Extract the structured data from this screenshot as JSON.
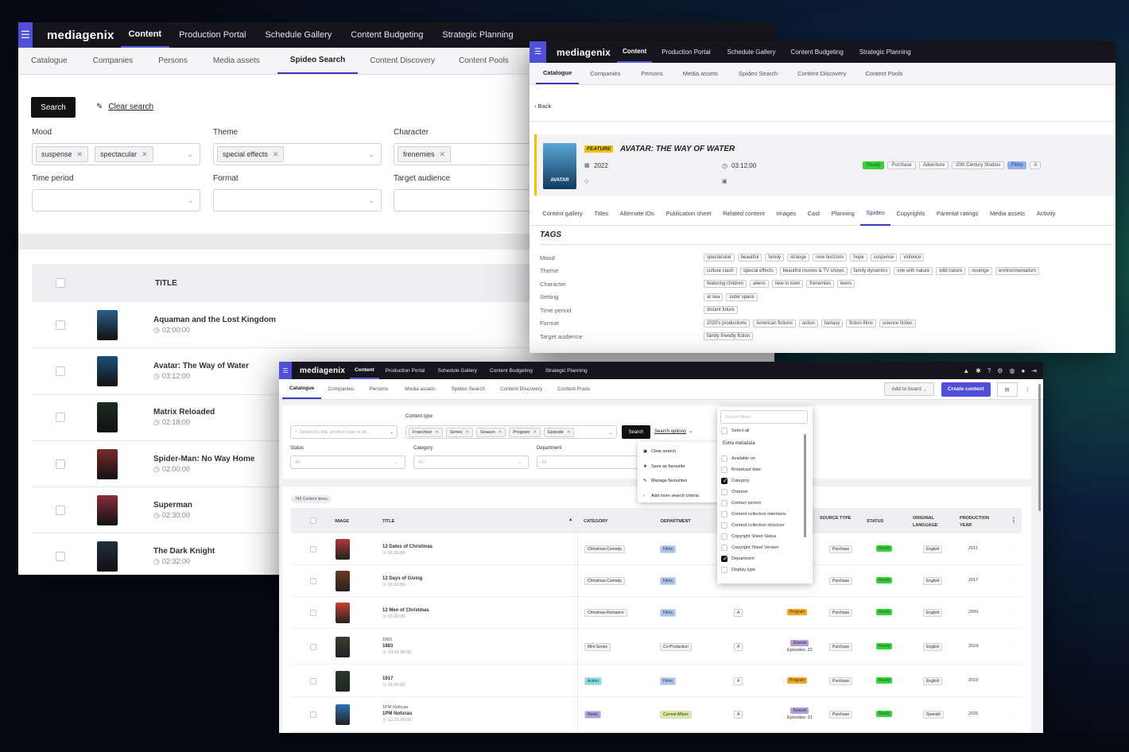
{
  "app": {
    "logo": "mediagenix",
    "top_nav": [
      "Content",
      "Production Portal",
      "Schedule Gallery",
      "Content Budgeting",
      "Strategic Planning"
    ],
    "sub_nav": [
      "Catalogue",
      "Companies",
      "Persons",
      "Media assets",
      "Spideo Search",
      "Content Discovery",
      "Content Pools"
    ]
  },
  "search_window": {
    "search_button": "Search",
    "clear_search": "Clear search",
    "filters": [
      {
        "label": "Mood",
        "chips": [
          "suspense",
          "spectacular"
        ]
      },
      {
        "label": "Theme",
        "chips": [
          "special effects"
        ]
      },
      {
        "label": "Character",
        "chips": [
          "frenemies"
        ]
      },
      {
        "label": "Time period",
        "chips": []
      },
      {
        "label": "Format",
        "chips": []
      },
      {
        "label": "Target audience",
        "chips": []
      }
    ],
    "table_header": "TITLE",
    "rows": [
      {
        "title": "Aquaman and the Lost Kingdom",
        "duration": "02:00:00",
        "color": "#2b5f8a"
      },
      {
        "title": "Avatar: The Way of Water",
        "duration": "03:12:00",
        "color": "#1d4f7a"
      },
      {
        "title": "Matrix Reloaded",
        "duration": "02:18:00",
        "color": "#1d2b22"
      },
      {
        "title": "Spider-Man: No Way Home",
        "duration": "02:00:00",
        "color": "#7a2c2c"
      },
      {
        "title": "Superman",
        "duration": "02:30:00",
        "color": "#8a2d3a"
      },
      {
        "title": "The Dark Knight",
        "duration": "02:32:00",
        "color": "#20303d"
      }
    ]
  },
  "detail_window": {
    "back": "Back",
    "badge": "FEATURE",
    "title": "AVATAR: THE WAY OF WATER",
    "year": "2022",
    "duration": "03:12:00",
    "poster_text": "AVATAR",
    "status_tags": [
      "Ready",
      "Purchase",
      "Adventure",
      "20th Century Studios",
      "Films",
      "A"
    ],
    "tabs": [
      "Content gallery",
      "Titles",
      "Alternate IDs",
      "Publication sheet",
      "Related content",
      "Images",
      "Cast",
      "Planning",
      "Spideo",
      "Copyrights",
      "Parental ratings",
      "Media assets",
      "Activity"
    ],
    "tags_heading": "TAGS",
    "tag_rows": [
      {
        "label": "Mood",
        "tags": [
          "spectacular",
          "beautiful",
          "family",
          "strange",
          "new horizons",
          "hope",
          "suspense",
          "violence"
        ]
      },
      {
        "label": "Theme",
        "tags": [
          "culture clash",
          "special effects",
          "beautiful movies & TV shows",
          "family dynamics",
          "one with nature",
          "wild nature",
          "revenge",
          "environmentalism"
        ]
      },
      {
        "label": "Character",
        "tags": [
          "featuring children",
          "aliens",
          "new in town",
          "frenemies",
          "teens"
        ]
      },
      {
        "label": "Setting",
        "tags": [
          "at sea",
          "outer space"
        ]
      },
      {
        "label": "Time period",
        "tags": [
          "distant future"
        ]
      },
      {
        "label": "Format",
        "tags": [
          "2020's productions",
          "American fictions",
          "action",
          "fantasy",
          "fiction films",
          "science fiction"
        ]
      },
      {
        "label": "Target audience",
        "tags": [
          "family friendly fiction"
        ]
      }
    ]
  },
  "catalogue_window": {
    "add_to_board": "Add to board",
    "create_content": "Create content",
    "search_placeholder": "Search by title, product code or alt...",
    "content_type_label": "Content type",
    "content_types": [
      "Franchise",
      "Series",
      "Season",
      "Program",
      "Episode"
    ],
    "search_button": "Search",
    "search_options": "Search options",
    "status_label": "Status",
    "category_label": "Category",
    "department_label": "Department",
    "all": "All",
    "options_menu": [
      "Clear search",
      "Save as favourite",
      "Manage favourites",
      "Add more search criteria"
    ],
    "filter_panel": {
      "placeholder": "Search filters",
      "select_all": "Select all",
      "section": "Extra metadata",
      "items": [
        {
          "label": "Available on",
          "checked": false
        },
        {
          "label": "Broadcast date",
          "checked": false
        },
        {
          "label": "Category",
          "checked": true
        },
        {
          "label": "Channel",
          "checked": false
        },
        {
          "label": "Contact person",
          "checked": false
        },
        {
          "label": "Content collection intentions",
          "checked": false
        },
        {
          "label": "Content collection structure",
          "checked": false
        },
        {
          "label": "Copyright Sheet Status",
          "checked": false
        },
        {
          "label": "Copyright Sheet Version",
          "checked": false
        },
        {
          "label": "Department",
          "checked": true
        },
        {
          "label": "Display type",
          "checked": false
        }
      ]
    },
    "count": "743 Content items",
    "columns": [
      "IMAGE",
      "TITLE",
      "CATEGORY",
      "DEPARTMENT",
      "SOURCE TYPE",
      "STATUS",
      "ORIGINAL LANGUAGE",
      "PRODUCTION YEAR"
    ],
    "rows": [
      {
        "pre": "",
        "title": "12 Dates of Christmas",
        "sub": "01:30:00",
        "category": "Christmas-Comedy",
        "cat_color": "#f3f3f5",
        "department": "Films",
        "dep_color": "#a7c4f2",
        "rating": "",
        "type": "",
        "type_color": "",
        "episodes": "",
        "source": "Purchase",
        "status": "Ready",
        "lang": "English",
        "year": "2011",
        "img": "#b03a3a"
      },
      {
        "pre": "",
        "title": "12 Days of Giving",
        "sub": "01:30:00",
        "category": "Christmas-Comedy",
        "cat_color": "#f3f3f5",
        "department": "Films",
        "dep_color": "#a7c4f2",
        "rating": "",
        "type": "",
        "type_color": "",
        "episodes": "",
        "source": "Purchase",
        "status": "Ready",
        "lang": "English",
        "year": "2017",
        "img": "#6b3b1e"
      },
      {
        "pre": "",
        "title": "12 Men of Christmas",
        "sub": "01:30:00",
        "category": "Christmas-Romance",
        "cat_color": "#f3f3f5",
        "department": "Films",
        "dep_color": "#a7c4f2",
        "rating": "A",
        "type": "Program",
        "type_color": "#f5a623",
        "episodes": "",
        "source": "Purchase",
        "status": "Ready",
        "lang": "English",
        "year": "2009",
        "img": "#c8402e"
      },
      {
        "pre": "1883",
        "title": "1883",
        "sub": "S1  01:00:00",
        "category": "Mini-Series",
        "cat_color": "#f3f3f5",
        "department": "Co-Production",
        "dep_color": "#f3f3f5",
        "rating": "A",
        "type": "Season",
        "type_color": "#b39ddb",
        "episodes": "Episodes: 22",
        "source": "Purchase",
        "status": "Ready",
        "lang": "English",
        "year": "2024",
        "img": "#3d3a33"
      },
      {
        "pre": "",
        "title": "1917",
        "sub": "01:59:00",
        "category": "Action",
        "cat_color": "#7ee0e0",
        "department": "Films",
        "dep_color": "#a7c4f2",
        "rating": "A",
        "type": "Program",
        "type_color": "#f5a623",
        "episodes": "",
        "source": "Purchase",
        "status": "Ready",
        "lang": "English",
        "year": "2019",
        "img": "#2a3a2a"
      },
      {
        "pre": "1PM Noticias",
        "title": "1PM Noticias",
        "sub": "S1  01:00:00",
        "category": "News",
        "cat_color": "#b39ddb",
        "department": "Current Affairs",
        "dep_color": "#d9ef9a",
        "rating": "A",
        "type": "Season",
        "type_color": "#b39ddb",
        "episodes": "Episodes: 31",
        "source": "Purchase",
        "status": "Ready",
        "lang": "Spanish",
        "year": "2025",
        "img": "#2c6fb0"
      }
    ]
  }
}
